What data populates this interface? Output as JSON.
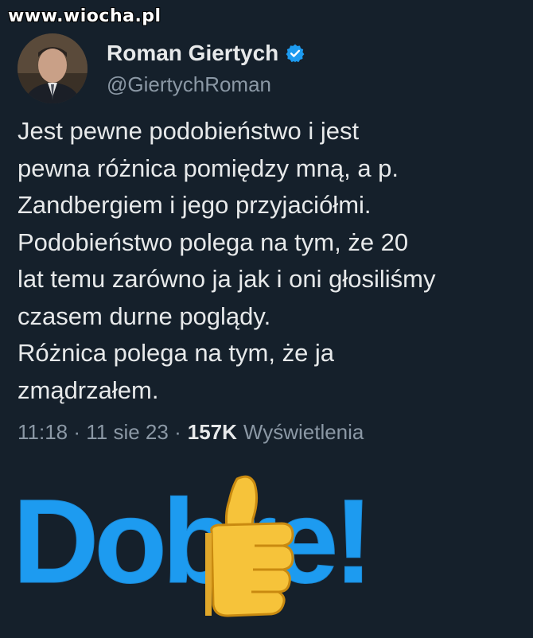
{
  "watermark": "www.wiocha.pl",
  "author": {
    "name": "Roman Giertych",
    "handle": "@GiertychRoman",
    "verified": true
  },
  "tweet": {
    "text": "Jest pewne podobieństwo i jest\npewna różnica pomiędzy mną, a p.\nZandbergiem i jego przyjaciółmi.\nPodobieństwo polega na tym, że 20\nlat temu zarówno ja jak i oni głosiliśmy\nczasem durne poglądy.\nRóżnica polega na tym, że ja\nzmądrzałem."
  },
  "meta": {
    "time": "11:18",
    "date": "11 sie 23",
    "views_count": "157K",
    "views_label": "Wyświetlenia"
  },
  "overlay": {
    "text": "Dobre!",
    "text_color": "#1d9bf0",
    "icon": "thumbs-up-icon"
  },
  "colors": {
    "background": "#15202b",
    "text": "#e7e9ea",
    "secondary": "#8b98a5",
    "accent": "#1d9bf0"
  }
}
